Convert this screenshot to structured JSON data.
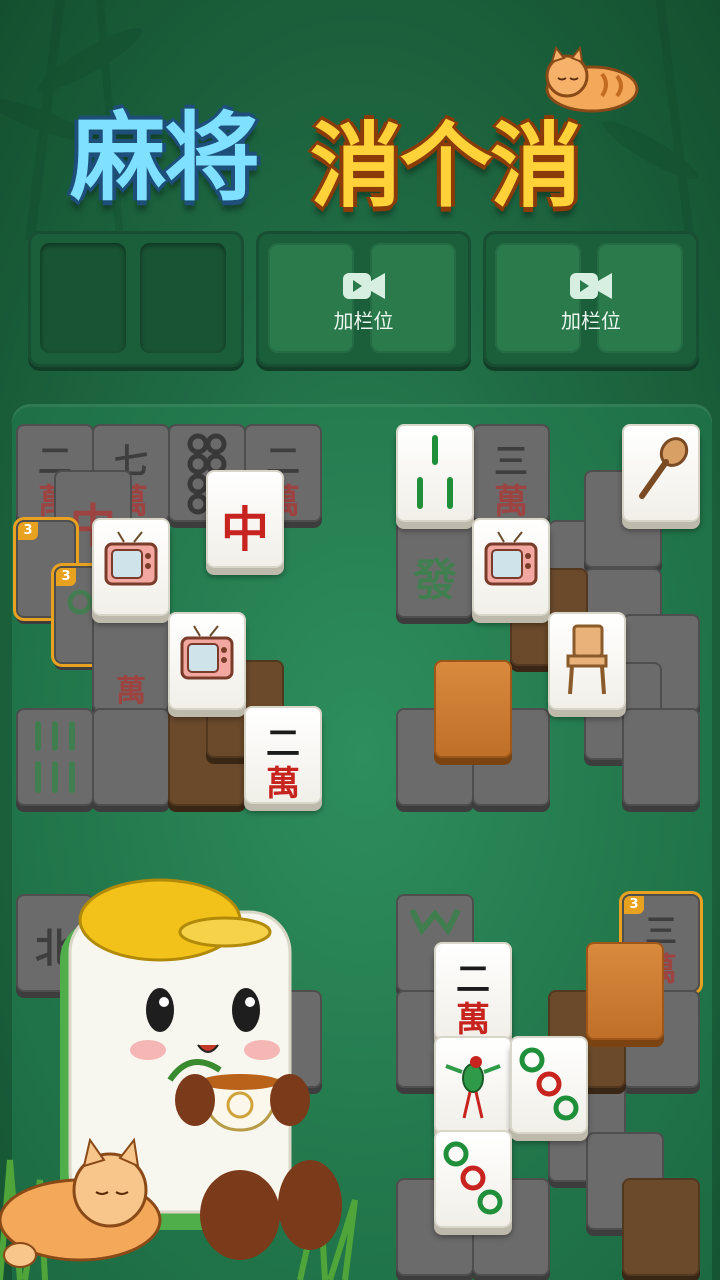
{
  "title": {
    "part1": "麻将",
    "part2": "消个消"
  },
  "slots": {
    "unlock_label": "加栏位",
    "groups": [
      {
        "slots": [
          "",
          ""
        ]
      },
      {
        "slots": [
          "",
          ""
        ],
        "unlock_label": "加栏位"
      },
      {
        "slots": [
          "",
          ""
        ],
        "unlock_label": "加栏位"
      }
    ]
  },
  "board": {
    "tiles": [
      {
        "name": "tile-er-wan",
        "style": "dark",
        "chars": [
          "二",
          "萬"
        ]
      },
      {
        "name": "tile-qi-wan",
        "style": "dark",
        "chars": [
          "七",
          "萬"
        ]
      },
      {
        "name": "tile-circles",
        "style": "dark",
        "chars": [
          "⦿⦿",
          "⦿⦿"
        ]
      },
      {
        "name": "tile-er-wan-2",
        "style": "dark",
        "chars": [
          "二",
          "萬"
        ]
      },
      {
        "name": "tile-zhong-dark",
        "style": "dark",
        "chars": [
          "中",
          ""
        ]
      },
      {
        "name": "tile-zhong",
        "style": "light",
        "chars": [
          "中",
          ""
        ]
      },
      {
        "name": "tile-tv",
        "style": "light",
        "chars": [
          "TV",
          ""
        ]
      },
      {
        "name": "tile-tv-2",
        "style": "light",
        "chars": [
          "TV",
          ""
        ]
      },
      {
        "name": "tile-er-wan-3",
        "style": "light",
        "chars": [
          "二",
          "萬"
        ]
      },
      {
        "name": "tile-bamboo",
        "style": "light",
        "chars": [
          "",
          ""
        ]
      },
      {
        "name": "tile-san-wan",
        "style": "dark",
        "chars": [
          "三",
          "萬"
        ]
      },
      {
        "name": "tile-spoon",
        "style": "light",
        "chars": [
          "",
          ""
        ]
      },
      {
        "name": "tile-fa",
        "style": "dark",
        "chars": [
          "發",
          ""
        ]
      },
      {
        "name": "tile-tv-3",
        "style": "light",
        "chars": [
          "TV",
          ""
        ]
      },
      {
        "name": "tile-chair",
        "style": "light",
        "chars": [
          "",
          ""
        ]
      },
      {
        "name": "tile-wood",
        "style": "wood",
        "chars": [
          "",
          ""
        ]
      },
      {
        "name": "tile-er-wan-4",
        "style": "light",
        "chars": [
          "二",
          "萬"
        ]
      },
      {
        "name": "tile-bird",
        "style": "light",
        "chars": [
          "",
          ""
        ]
      },
      {
        "name": "tile-three-circles",
        "style": "light",
        "chars": [
          "",
          ""
        ]
      },
      {
        "name": "tile-three-circles-2",
        "style": "light",
        "chars": [
          "",
          ""
        ]
      },
      {
        "name": "tile-wood-2",
        "style": "wood",
        "chars": [
          "",
          ""
        ]
      },
      {
        "name": "tile-san-wan-2",
        "style": "dark",
        "chars": [
          "三",
          "萬"
        ]
      },
      {
        "name": "tile-bei",
        "style": "dark",
        "chars": [
          "北",
          ""
        ]
      }
    ],
    "badges": [
      "3",
      "3",
      "3"
    ]
  },
  "colors": {
    "bg": "#1f6b44",
    "title_blue": "#7fe0ff",
    "title_gold": "#ffd23a",
    "badge": "#e8a21f"
  }
}
